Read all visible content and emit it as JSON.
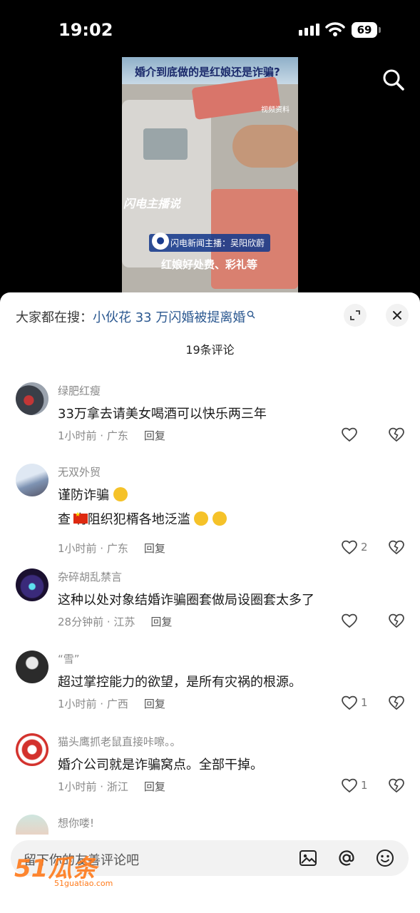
{
  "status": {
    "time": "19:02",
    "battery": "69"
  },
  "video": {
    "banner_line": "婚介到底做的是红娘还是诈骗?",
    "source_tag": "视频资料",
    "logo": "闪电主播说",
    "anchor": "闪电新闻主播：吴阳欣蔚",
    "subtitle": "红娘好处费、彩礼等"
  },
  "sheet": {
    "search_prefix": "大家都在搜：",
    "search_term": "小伙花 33 万闪婚被提离婚",
    "comment_count": "19条评论",
    "comments": [
      {
        "user": "绿肥红瘦",
        "lines": [
          "33万拿去请美女喝酒可以快乐两三年"
        ],
        "time": "1小时前 · 广东",
        "reply": "回复",
        "likes": ""
      },
      {
        "user": "无双外贸",
        "lines": [
          "谨防诈骗",
          "查 有阻织犯楈各地泛滥"
        ],
        "time": "1小时前 · 广东",
        "reply": "回复",
        "likes": "2"
      },
      {
        "user": "杂碎胡乱禁言",
        "lines": [
          "这种以处对象结婚诈骗圈套做局设圈套太多了"
        ],
        "time": "28分钟前 · 江苏",
        "reply": "回复",
        "likes": ""
      },
      {
        "user": "“雪”",
        "lines": [
          "超过掌控能力的欲望，是所有灾祸的根源。"
        ],
        "time": "1小时前 · 广西",
        "reply": "回复",
        "likes": "1"
      },
      {
        "user": "猫头鹰抓老鼠直接咔嚓。。",
        "lines": [
          "婚介公司就是诈骗窝点。全部干掉。"
        ],
        "time": "1小时前 · 浙江",
        "reply": "回复",
        "likes": "1"
      },
      {
        "user": "想你喽!",
        "lines": [],
        "time": "",
        "reply": "",
        "likes": ""
      }
    ],
    "input_placeholder": "留下你的友善评论吧",
    "watermark": "51瓜条",
    "watermark_sub": "51guatiao.com"
  }
}
